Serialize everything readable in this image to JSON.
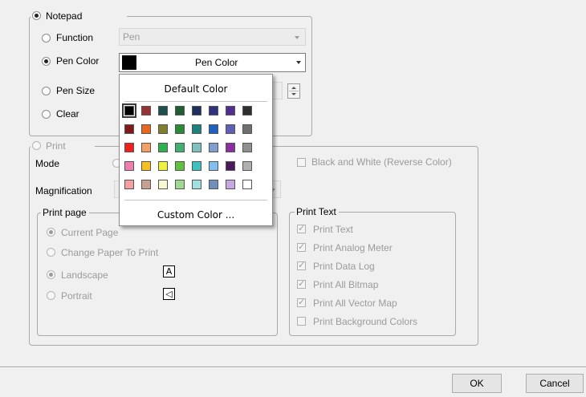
{
  "notepad": {
    "title": "Notepad",
    "function_label": "Function",
    "function_value": "Pen",
    "pen_color_label": "Pen Color",
    "pen_color_value": "Pen Color",
    "pen_color_swatch": "#000000",
    "pen_size_label": "Pen Size",
    "clear_label": "Clear"
  },
  "color_popup": {
    "default_label": "Default Color",
    "custom_label": "Custom Color ...",
    "colors": [
      [
        "#000000",
        "#993333",
        "#1f4f4f",
        "#1f5f2f",
        "#1f2f5f",
        "#2f3380",
        "#4f2f8f",
        "#2f2f2f"
      ],
      [
        "#801b1b",
        "#e8671f",
        "#7f7f2f",
        "#2a8a3a",
        "#1f8080",
        "#2060c0",
        "#6060b0",
        "#6f6f6f"
      ],
      [
        "#ee1f1f",
        "#f5a060",
        "#2fb04f",
        "#3fb070",
        "#80c0c0",
        "#7f9fcf",
        "#8a2fa0",
        "#8f8f8f"
      ],
      [
        "#ee80b0",
        "#f5c020",
        "#f0f040",
        "#60c040",
        "#40c0c0",
        "#80c0f0",
        "#4a1a5a",
        "#b0b0b0"
      ],
      [
        "#f5a0a0",
        "#c8a090",
        "#f8f8d0",
        "#a0d890",
        "#a0e0e0",
        "#6f8fbf",
        "#c8a8e0",
        "#ffffff"
      ]
    ]
  },
  "print": {
    "title": "Print",
    "mode_label": "Mode",
    "magnification_label": "Magnification",
    "bw_label": "Black and White (Reverse Color)",
    "print_page": {
      "title": "Print page",
      "current_page": "Current Page",
      "change_paper": "Change Paper To Print",
      "landscape": "Landscape",
      "portrait": "Portrait",
      "landscape_icon": "A",
      "portrait_icon": "◁"
    },
    "print_text": {
      "title": "Print Text",
      "items": [
        "Print Text",
        "Print Analog Meter",
        "Print Data Log",
        "Print All Bitmap",
        "Print All Vector Map",
        "Print Background Colors"
      ]
    }
  },
  "footer": {
    "ok_label": "OK",
    "cancel_label": "Cancel"
  }
}
